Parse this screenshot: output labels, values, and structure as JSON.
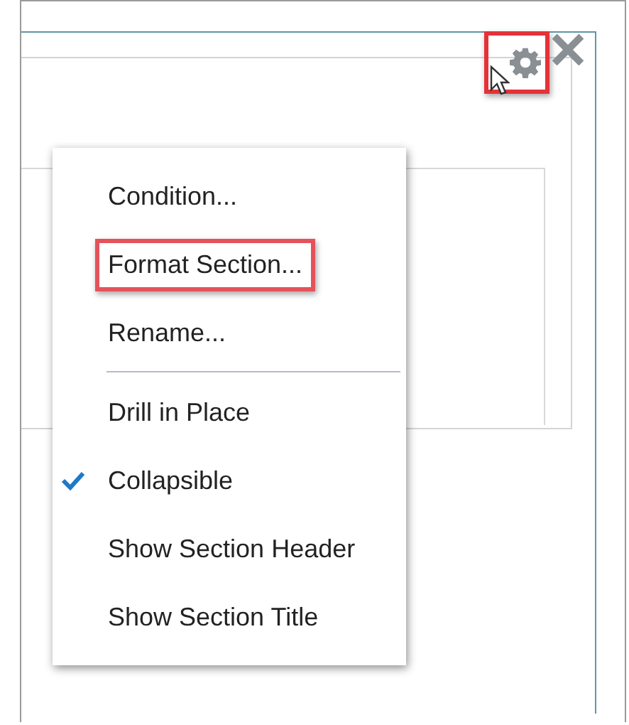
{
  "section_toolbar": {
    "settings_highlighted": true
  },
  "menu": {
    "items": [
      {
        "kind": "item",
        "label": "Condition...",
        "checked": false,
        "highlighted": false
      },
      {
        "kind": "item",
        "label": "Format Section...",
        "checked": false,
        "highlighted": true
      },
      {
        "kind": "item",
        "label": "Rename...",
        "checked": false,
        "highlighted": false
      },
      {
        "kind": "separator"
      },
      {
        "kind": "item",
        "label": "Drill in Place",
        "checked": false,
        "highlighted": false
      },
      {
        "kind": "item",
        "label": "Collapsible",
        "checked": true,
        "highlighted": false
      },
      {
        "kind": "item",
        "label": "Show Section Header",
        "checked": false,
        "highlighted": false
      },
      {
        "kind": "item",
        "label": "Show Section Title",
        "checked": false,
        "highlighted": false
      }
    ]
  }
}
